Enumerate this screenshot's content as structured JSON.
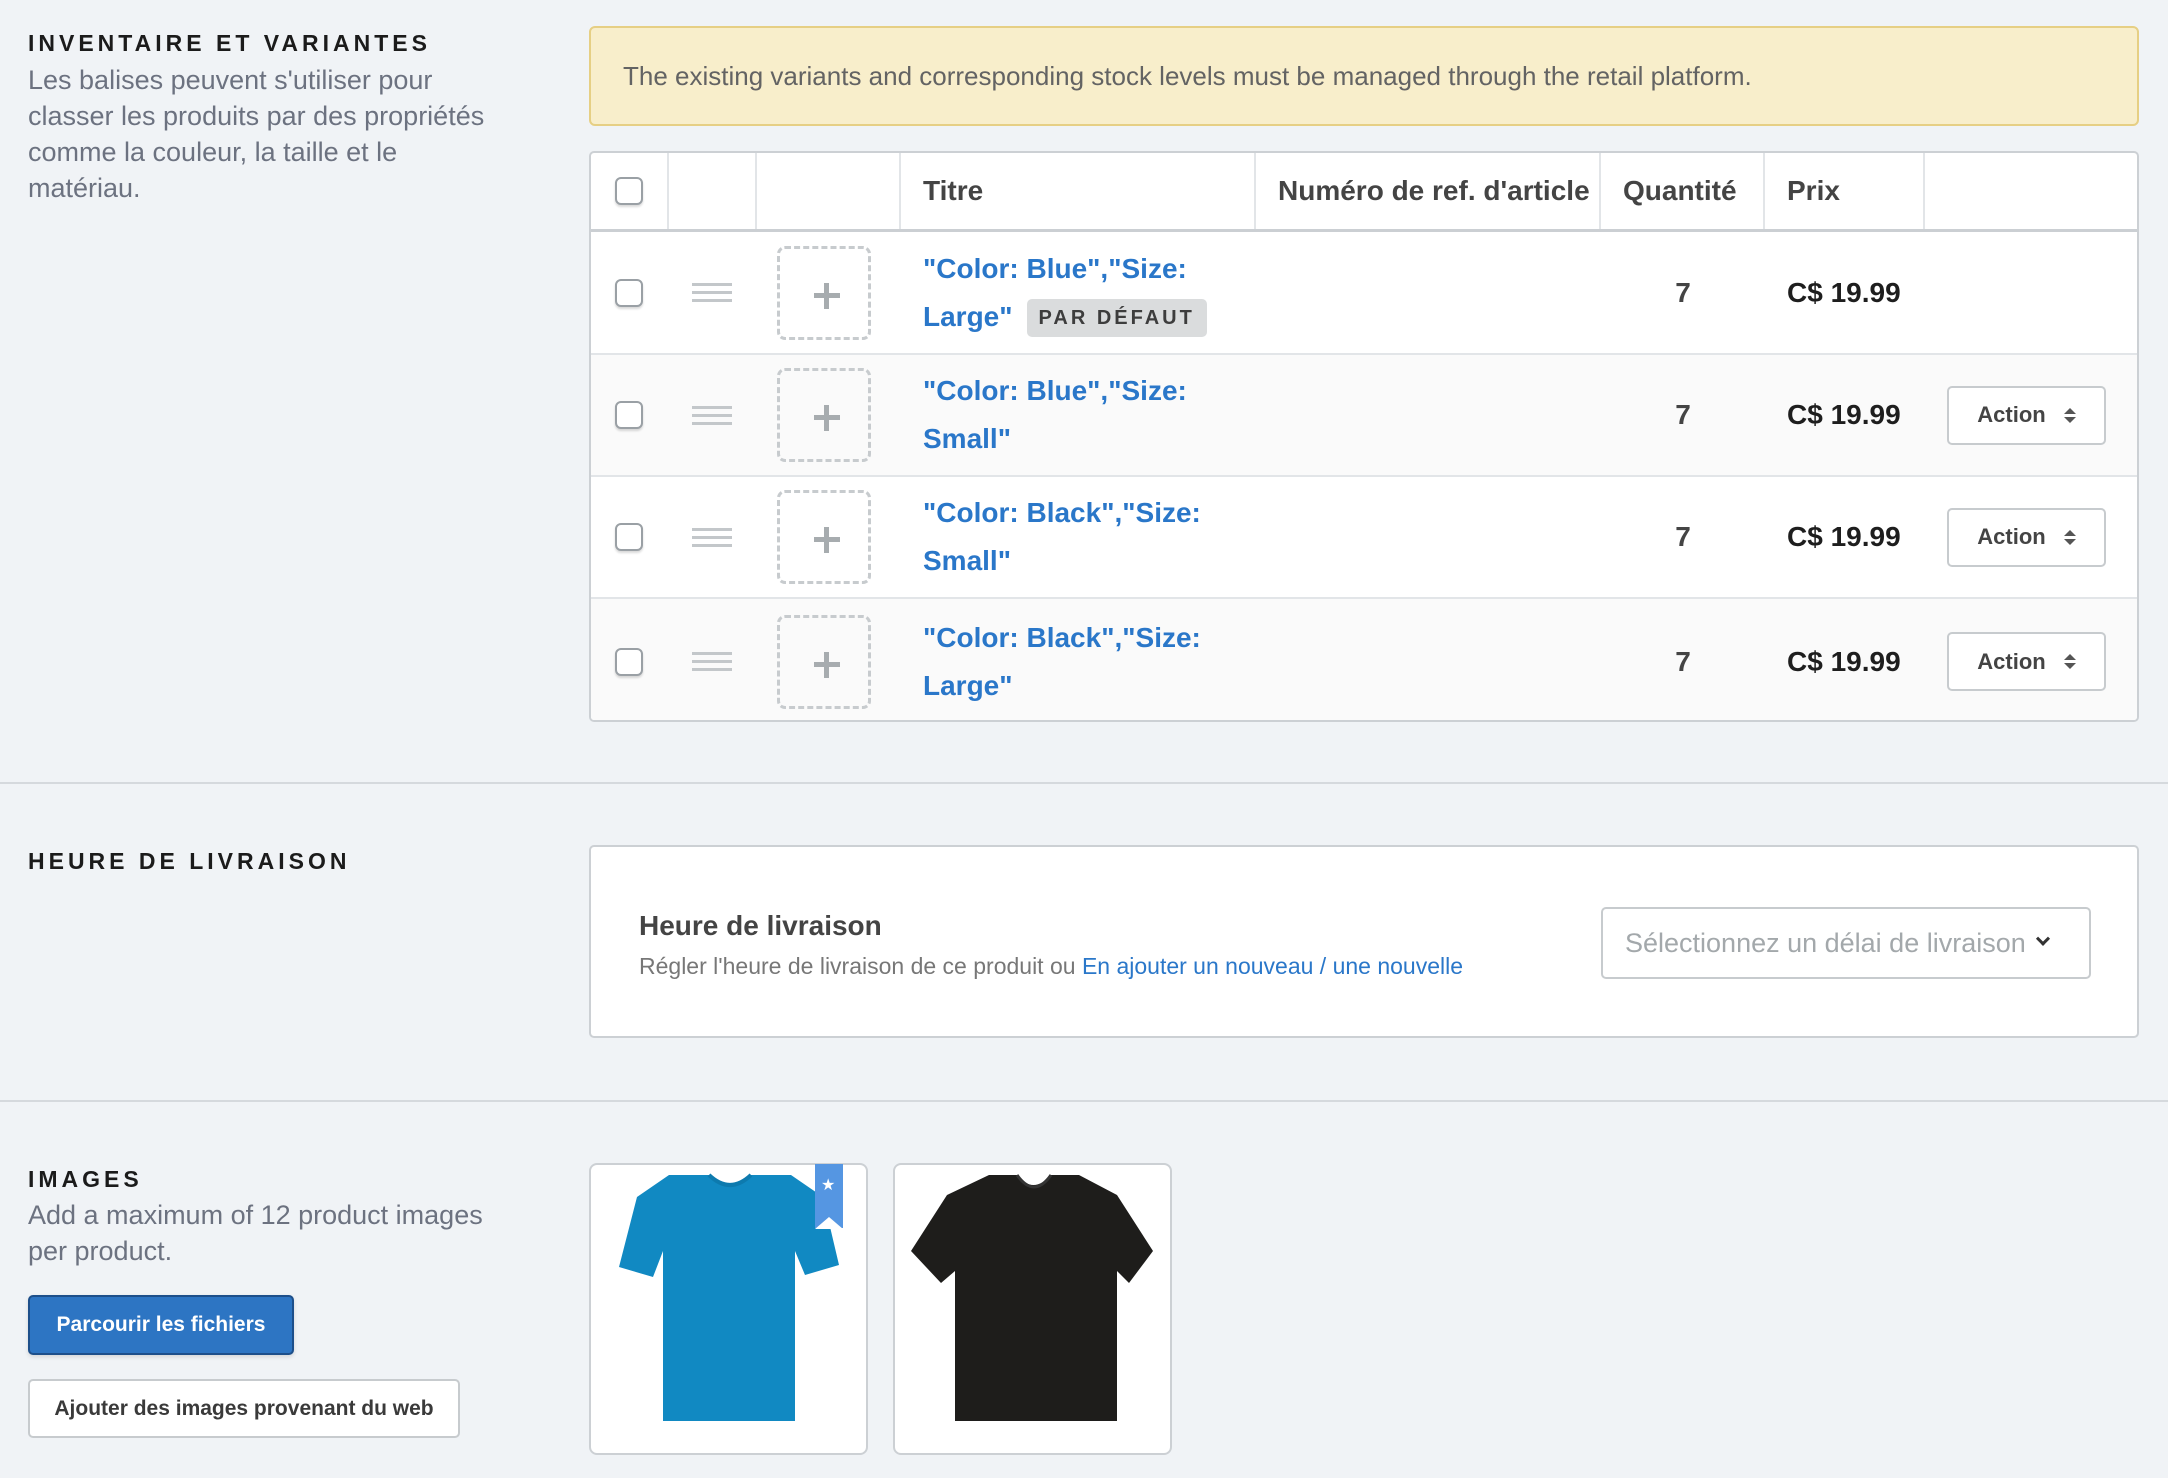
{
  "inventory": {
    "title": "INVENTAIRE ET VARIANTES",
    "description": "Les balises peuvent s'utiliser pour classer les produits par des propriétés comme la couleur, la taille et le matériau.",
    "warning": "The existing variants and corresponding stock levels must be managed through the retail platform.",
    "columns": [
      "",
      "",
      "",
      "Titre",
      "Numéro de ref. d'article",
      "Quantité",
      "Prix",
      ""
    ],
    "rows": [
      {
        "title": "\"Color: Blue\",\"Size: Large\"",
        "title_line1": "\"Color: Blue\",\"Size:",
        "title_line2": "Large\"",
        "badge": "PAR DÉFAUT",
        "sku": "",
        "quantity": "7",
        "price": "C$ 19.99",
        "action": ""
      },
      {
        "title": "\"Color: Blue\",\"Size: Small\"",
        "title_line1": "\"Color: Blue\",\"Size:",
        "title_line2": "Small\"",
        "badge": "",
        "sku": "",
        "quantity": "7",
        "price": "C$ 19.99",
        "action": "Action"
      },
      {
        "title": "\"Color: Black\",\"Size: Small\"",
        "title_line1": "\"Color: Black\",\"Size:",
        "title_line2": "Small\"",
        "badge": "",
        "sku": "",
        "quantity": "7",
        "price": "C$ 19.99",
        "action": "Action"
      },
      {
        "title": "\"Color: Black\",\"Size: Large\"",
        "title_line1": "\"Color: Black\",\"Size:",
        "title_line2": "Large\"",
        "badge": "",
        "sku": "",
        "quantity": "7",
        "price": "C$ 19.99",
        "action": "Action"
      }
    ]
  },
  "delivery": {
    "section_title": "HEURE DE LIVRAISON",
    "card_title": "Heure de livraison",
    "card_text": "Régler l'heure de livraison de ce produit ou ",
    "card_link": "En ajouter un nouveau / une nouvelle",
    "select_placeholder": "Sélectionnez un délai de livraison"
  },
  "images": {
    "section_title": "IMAGES",
    "description": "Add a maximum of 12 product images per product.",
    "browse_button": "Parcourir les fichiers",
    "web_button": "Ajouter des images provenant du web",
    "items": [
      {
        "alt": "blue t-shirt",
        "color": "#1189c2",
        "featured": true
      },
      {
        "alt": "black t-shirt",
        "color": "#1e1d1b",
        "featured": false
      }
    ]
  },
  "colors": {
    "link": "#2a77c9",
    "primary_button": "#2d75c3",
    "warning_bg": "#f8eecb",
    "page_bg": "#f0f3f6"
  }
}
